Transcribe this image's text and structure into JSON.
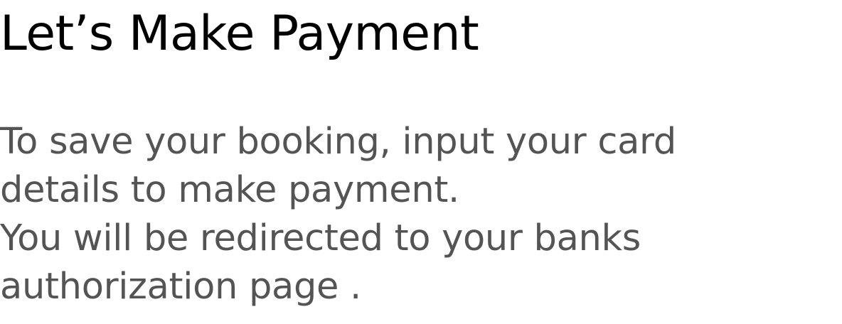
{
  "page": {
    "title": "Let’s Make Payment",
    "description_lines": [
      "To save your booking, input your card",
      "details to make payment.",
      "You will be redirected to your banks",
      "authorization page ."
    ]
  },
  "colors": {
    "background": "#ffffff",
    "title": "#000000",
    "body_text": "#545454"
  }
}
